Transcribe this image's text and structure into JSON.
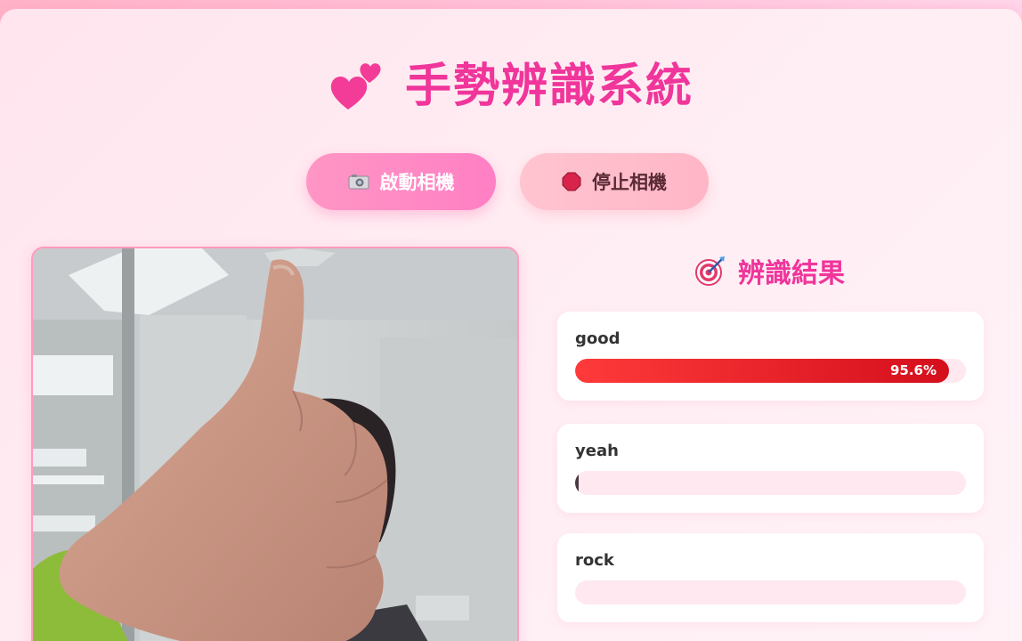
{
  "header": {
    "title": "手勢辨識系統",
    "icon": "two-hearts-icon"
  },
  "controls": {
    "start_label": "啟動相機",
    "start_icon": "camera-icon",
    "stop_label": "停止相機",
    "stop_icon": "stop-sign-icon"
  },
  "results": {
    "title": "辨識結果",
    "icon": "direct-hit-target-icon",
    "items": [
      {
        "label": "good",
        "percent_text": "95.6%",
        "value": 0.956
      },
      {
        "label": "yeah",
        "percent_text": "",
        "value": 0.005
      },
      {
        "label": "rock",
        "percent_text": "",
        "value": 0.0
      }
    ]
  },
  "colors": {
    "accent": "#f0359b",
    "bar_red": "#e01a22",
    "bar_track": "#ffe8ef"
  }
}
